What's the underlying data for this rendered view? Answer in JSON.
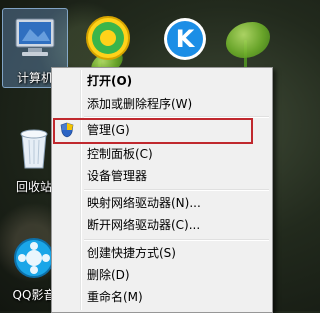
{
  "desktop": {
    "icons": [
      {
        "label": "计算机",
        "icon": "computer-icon"
      },
      {
        "label": "回收站",
        "icon": "recycle-bin-icon"
      },
      {
        "label": "QQ影音",
        "icon": "qq-player-icon"
      }
    ],
    "apps": [
      {
        "icon": "360-security-icon"
      },
      {
        "icon": "kugou-k-icon",
        "glyph": "K"
      }
    ]
  },
  "context_menu": {
    "items": [
      {
        "label": "打开(O)",
        "bold": true
      },
      {
        "label": "添加或删除程序(W)"
      },
      {
        "label": "管理(G)",
        "icon": "shield-icon",
        "highlighted": true
      },
      {
        "label": "控制面板(C)"
      },
      {
        "label": "设备管理器"
      },
      {
        "label": "映射网络驱动器(N)..."
      },
      {
        "label": "断开网络驱动器(C)..."
      },
      {
        "label": "创建快捷方式(S)"
      },
      {
        "label": "删除(D)"
      },
      {
        "label": "重命名(M)"
      }
    ]
  },
  "colors": {
    "highlight_border": "#c0282e",
    "menu_bg": "#f0f0f0"
  }
}
